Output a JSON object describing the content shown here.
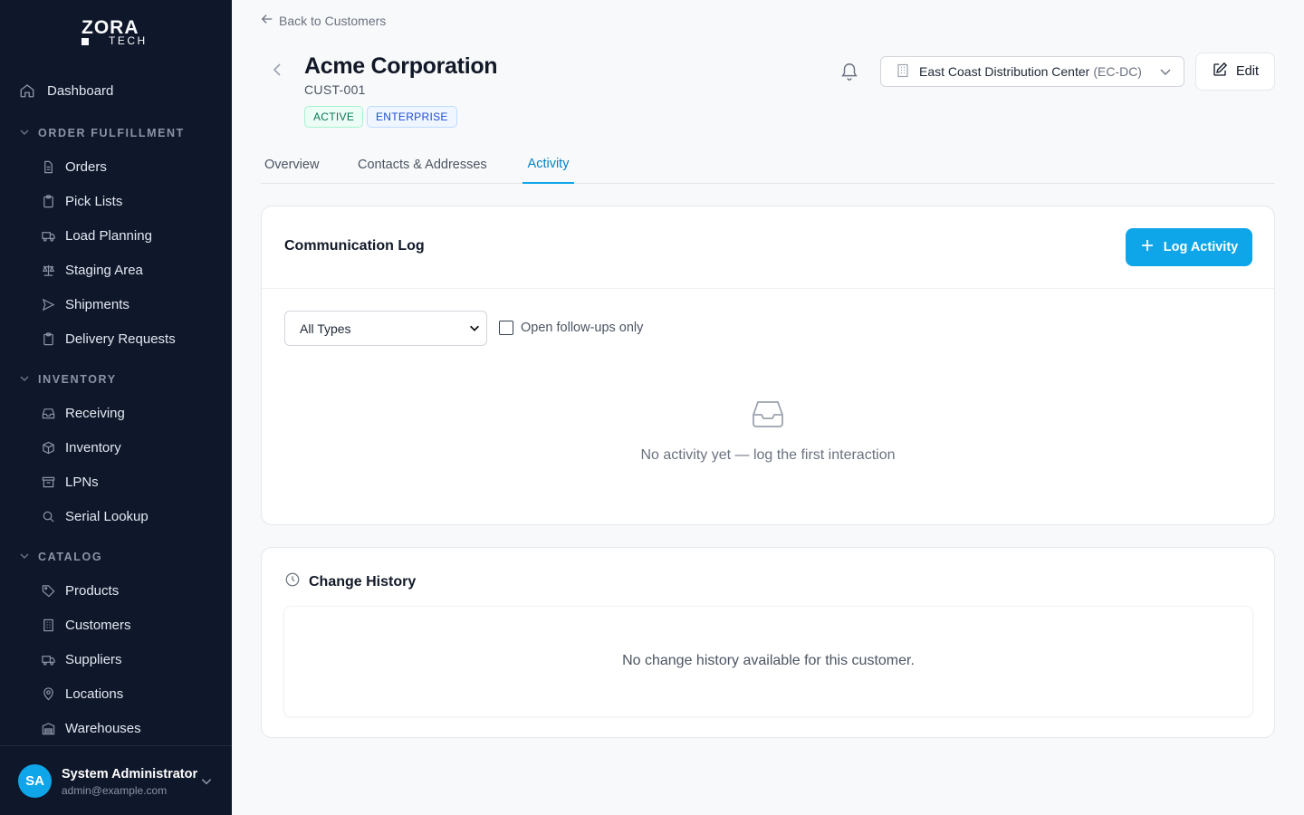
{
  "brand": {
    "logo_top": "ZORA",
    "logo_bottom": "TECH"
  },
  "sidebar": {
    "dashboard": {
      "label": "Dashboard",
      "icon": "home-icon"
    },
    "sections": [
      {
        "label": "ORDER FULFILLMENT",
        "items": [
          {
            "label": "Orders",
            "icon": "document-icon"
          },
          {
            "label": "Pick Lists",
            "icon": "clipboard-icon"
          },
          {
            "label": "Load Planning",
            "icon": "truck-icon"
          },
          {
            "label": "Staging Area",
            "icon": "scale-icon"
          },
          {
            "label": "Shipments",
            "icon": "send-icon"
          },
          {
            "label": "Delivery Requests",
            "icon": "clipboard-icon"
          }
        ]
      },
      {
        "label": "INVENTORY",
        "items": [
          {
            "label": "Receiving",
            "icon": "inbox-icon"
          },
          {
            "label": "Inventory",
            "icon": "box-icon"
          },
          {
            "label": "LPNs",
            "icon": "archive-icon"
          },
          {
            "label": "Serial Lookup",
            "icon": "search-icon"
          }
        ]
      },
      {
        "label": "CATALOG",
        "items": [
          {
            "label": "Products",
            "icon": "tag-icon"
          },
          {
            "label": "Customers",
            "icon": "building-icon"
          },
          {
            "label": "Suppliers",
            "icon": "truck-icon"
          },
          {
            "label": "Locations",
            "icon": "pin-icon"
          },
          {
            "label": "Warehouses",
            "icon": "warehouse-icon"
          }
        ]
      }
    ],
    "user": {
      "initials": "SA",
      "name": "System Administrator",
      "email": "admin@example.com"
    }
  },
  "header": {
    "back_label": "Back to Customers",
    "title": "Acme Corporation",
    "code": "CUST-001",
    "badges": [
      "ACTIVE",
      "ENTERPRISE"
    ],
    "warehouse": {
      "name": "East Coast Distribution Center",
      "code": "(EC-DC)"
    },
    "edit_label": "Edit"
  },
  "tabs": [
    "Overview",
    "Contacts & Addresses",
    "Activity"
  ],
  "active_tab": "Activity",
  "communication_log": {
    "title": "Communication Log",
    "log_button": "Log Activity",
    "type_filter": "All Types",
    "follow_up_label": "Open follow-ups only",
    "empty_text": "No activity yet — log the first interaction"
  },
  "change_history": {
    "title": "Change History",
    "empty_text": "No change history available for this customer."
  },
  "colors": {
    "sidebar_bg": "#0f172a",
    "accent": "#0ea5e9",
    "active_badge": "#047857",
    "enterprise_badge": "#1d4ed8"
  }
}
